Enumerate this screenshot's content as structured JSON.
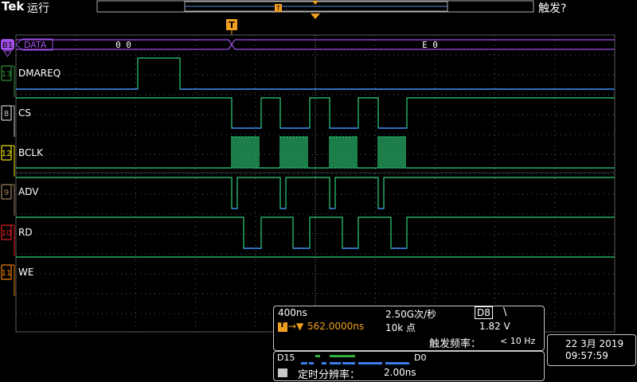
{
  "header": {
    "brand": "Tek",
    "run_state": "运行",
    "trigger_state": "触发?"
  },
  "trigger_marker": "T",
  "channels": [
    {
      "id": "B1",
      "label": "DATA",
      "color": "#a050e8"
    },
    {
      "id": "13",
      "label": "DMAREQ",
      "color": "#2f8f3a"
    },
    {
      "id": "8",
      "label": "CS",
      "color": "#c8c8c8"
    },
    {
      "id": "12",
      "label": "BCLK",
      "color": "#f0e000"
    },
    {
      "id": "9",
      "label": "ADV",
      "color": "#a08060"
    },
    {
      "id": "10",
      "label": "RD",
      "color": "#e02020"
    },
    {
      "id": "11",
      "label": "WE",
      "color": "#f08000"
    }
  ],
  "bus_values": [
    "0 0",
    "E 0"
  ],
  "timebase": {
    "scale": "400ns",
    "sample_rate": "2.50G次/秒",
    "record_length": "10k 点",
    "position": "562.0000ns"
  },
  "trigger": {
    "source": "D8",
    "slope": "\\",
    "level": "1.82 V",
    "frequency_label": "触发频率：",
    "frequency_value": "< 10 Hz"
  },
  "digital": {
    "high_label": "D15",
    "low_label": "D0",
    "resolution_label": "定时分辨率：",
    "resolution_value": "2.00ns"
  },
  "datetime": {
    "date": "22 3月 2019",
    "time": "09:57:59"
  },
  "colors": {
    "trace": "#2fd07a",
    "low": "#3a7ff0",
    "grid": "#5a5a5a",
    "bus": "#a050e8",
    "trigger": "#f0a020"
  }
}
